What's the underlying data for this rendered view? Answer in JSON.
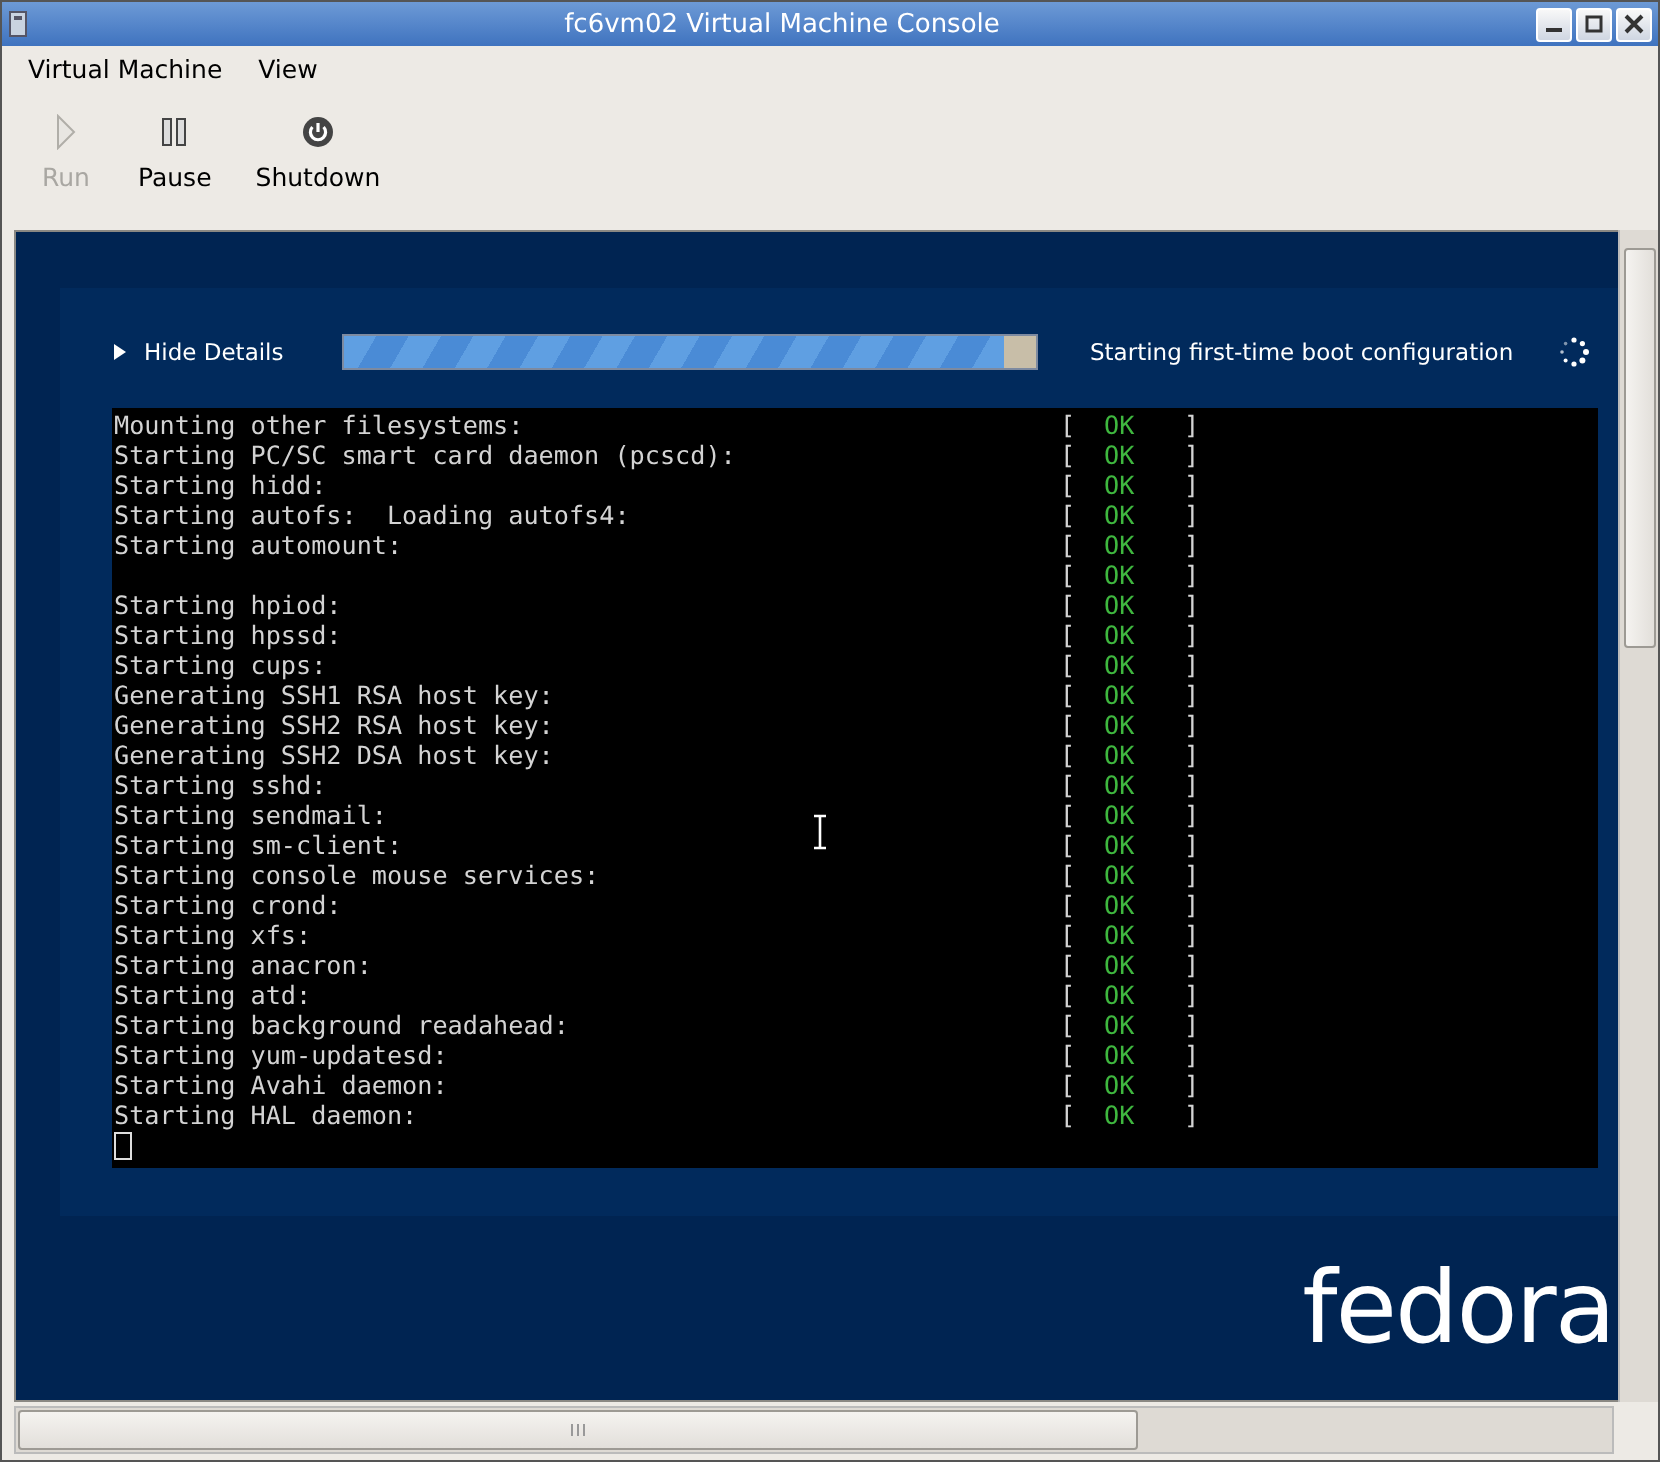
{
  "window": {
    "title": "fc6vm02 Virtual Machine Console"
  },
  "menu": [
    "Virtual Machine",
    "View"
  ],
  "toolbar": [
    {
      "kind": "run",
      "label": "Run",
      "disabled": true
    },
    {
      "kind": "pause",
      "label": "Pause",
      "disabled": false
    },
    {
      "kind": "shutdown",
      "label": "Shutdown",
      "disabled": false
    }
  ],
  "boot": {
    "toggle": "Hide Details",
    "expanded": true,
    "level": 0.955,
    "status": "Starting first-time boot configuration"
  },
  "log": [
    {
      "text": "Mounting other filesystems:",
      "open": "[",
      "status": "OK",
      "close": "]"
    },
    {
      "text": "Starting PC/SC smart card daemon (pcscd):",
      "open": "[",
      "status": "OK",
      "close": "]"
    },
    {
      "text": "Starting hidd:",
      "open": "[",
      "status": "OK",
      "close": "]"
    },
    {
      "text": "Starting autofs:  Loading autofs4:",
      "open": "[",
      "status": "OK",
      "close": "]"
    },
    {
      "text": "Starting automount:",
      "open": "[",
      "status": "OK",
      "close": "]"
    },
    {
      "open": "[",
      "status": "OK",
      "close": "]"
    },
    {
      "text": "Starting hpiod:",
      "open": "[",
      "status": "OK",
      "close": "]"
    },
    {
      "text": "Starting hpssd:",
      "open": "[",
      "status": "OK",
      "close": "]"
    },
    {
      "text": "Starting cups:",
      "open": "[",
      "status": "OK",
      "close": "]"
    },
    {
      "text": "Generating SSH1 RSA host key:",
      "open": "[",
      "status": "OK",
      "close": "]"
    },
    {
      "text": "Generating SSH2 RSA host key:",
      "open": "[",
      "status": "OK",
      "close": "]"
    },
    {
      "text": "Generating SSH2 DSA host key:",
      "open": "[",
      "status": "OK",
      "close": "]"
    },
    {
      "text": "Starting sshd:",
      "open": "[",
      "status": "OK",
      "close": "]"
    },
    {
      "text": "Starting sendmail:",
      "open": "[",
      "status": "OK",
      "close": "]"
    },
    {
      "text": "Starting sm-client:",
      "open": "[",
      "status": "OK",
      "close": "]"
    },
    {
      "text": "Starting console mouse services:",
      "open": "[",
      "status": "OK",
      "close": "]"
    },
    {
      "text": "Starting crond:",
      "open": "[",
      "status": "OK",
      "close": "]"
    },
    {
      "text": "Starting xfs:",
      "open": "[",
      "status": "OK",
      "close": "]"
    },
    {
      "text": "Starting anacron:",
      "open": "[",
      "status": "OK",
      "close": "]"
    },
    {
      "text": "Starting atd:",
      "open": "[",
      "status": "OK",
      "close": "]"
    },
    {
      "text": "Starting background readahead:",
      "open": "[",
      "status": "OK",
      "close": "]"
    },
    {
      "text": "Starting yum-updatesd:",
      "open": "[",
      "status": "OK",
      "close": "]"
    },
    {
      "text": "Starting Avahi daemon:",
      "open": "[",
      "status": "OK",
      "close": "]"
    },
    {
      "text": "Starting HAL daemon:",
      "open": "[",
      "status": "OK",
      "close": "]"
    }
  ],
  "logo": "fedora"
}
